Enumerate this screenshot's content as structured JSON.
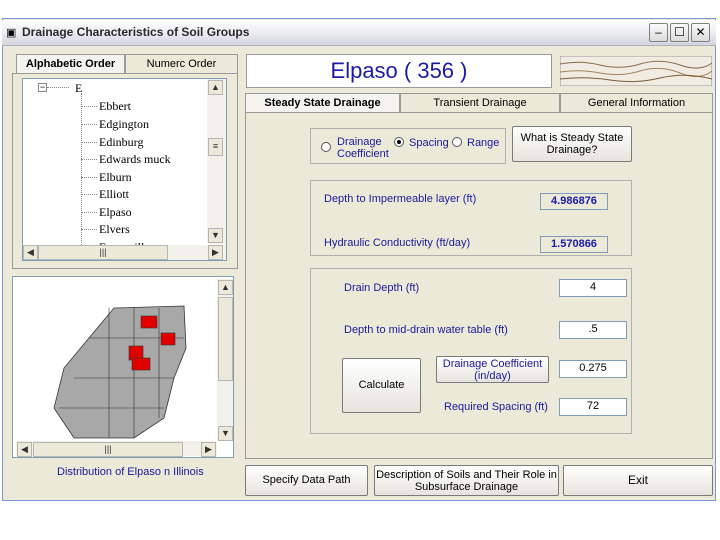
{
  "window": {
    "title": "Drainage Characteristics of Soil Groups"
  },
  "left_tabs": [
    "Alphabetic Order",
    "Numerc Order"
  ],
  "tree": {
    "root": "E",
    "items": [
      "Ebbert",
      "Edgington",
      "Edinburg",
      "Edwards muck",
      "Elburn",
      "Elliott",
      "Elpaso",
      "Elvers",
      "Evansville"
    ]
  },
  "soil_name": "Elpaso ( 356 )",
  "map_caption": "Distribution of Elpaso n Illinois",
  "right_tabs": [
    "Steady State Drainage",
    "Transient Drainage",
    "General Information"
  ],
  "mode": {
    "options": [
      "Drainage Coefficient",
      "Spacing",
      "Range"
    ],
    "selected": "Spacing"
  },
  "what_is_button": "What is Steady State Drainage?",
  "depth_impermeable": {
    "label": "Depth to Impermeable layer (ft)",
    "value": "4.986876"
  },
  "hydraulic_cond": {
    "label": "Hydraulic Conductivity (ft/day)",
    "value": "1.570866"
  },
  "drain_depth": {
    "label": "Drain Depth (ft)",
    "value": "4"
  },
  "water_table": {
    "label": "Depth to mid-drain water table (ft)",
    "value": ".5"
  },
  "drainage_coef": {
    "label": "Drainage Coefficient (in/day)",
    "value": "0.275"
  },
  "required_spacing": {
    "label": "Required Spacing (ft)",
    "value": "72"
  },
  "calculate_button": "Calculate",
  "bottom_buttons": {
    "data_path": "Specify Data Path",
    "description": "Description of Soils and Their Role in Subsurface Drainage",
    "exit": "Exit"
  },
  "colors": {
    "title_blue": "#1a1aa8",
    "highlight_red": "#e00000",
    "county_gray": "#a8a8a8"
  }
}
